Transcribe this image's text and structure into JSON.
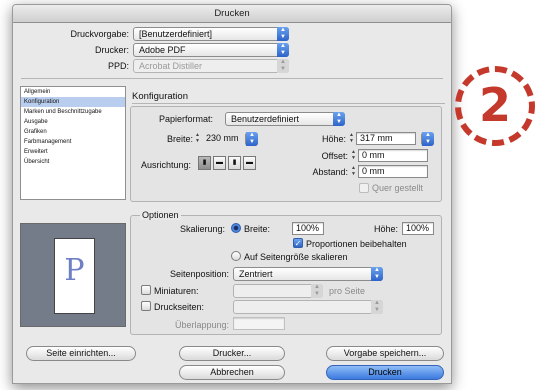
{
  "window": {
    "title": "Drucken"
  },
  "top": {
    "preset_label": "Druckvorgabe:",
    "preset_value": "[Benutzerdefiniert]",
    "printer_label": "Drucker:",
    "printer_value": "Adobe PDF",
    "ppd_label": "PPD:",
    "ppd_value": "Acrobat Distiller"
  },
  "sidebar": {
    "items": [
      {
        "label": "Allgemein",
        "selected": false
      },
      {
        "label": "Konfiguration",
        "selected": true
      },
      {
        "label": "Marken und Beschnittzugabe",
        "selected": false
      },
      {
        "label": "Ausgabe",
        "selected": false
      },
      {
        "label": "Grafiken",
        "selected": false
      },
      {
        "label": "Farbmanagement",
        "selected": false
      },
      {
        "label": "Erweitert",
        "selected": false
      },
      {
        "label": "Übersicht",
        "selected": false
      }
    ]
  },
  "preview": {
    "letter": "P"
  },
  "konfiguration": {
    "section_title": "Konfiguration",
    "paper_label": "Papierformat:",
    "paper_value": "Benutzerdefiniert",
    "width_label": "Breite:",
    "width_value": "230 mm",
    "height_label": "Höhe:",
    "height_value": "317 mm",
    "offset_label": "Offset:",
    "offset_value": "0 mm",
    "gap_label": "Abstand:",
    "gap_value": "0 mm",
    "orientation_label": "Ausrichtung:",
    "transverse_label": "Quer gestellt"
  },
  "optionen": {
    "section_title": "Optionen",
    "scaling_label": "Skalierung:",
    "width_radio_label": "Breite:",
    "width_value": "100%",
    "height_label": "Höhe:",
    "height_value": "100%",
    "proportions_label": "Proportionen beibehalten",
    "fit_label": "Auf Seitengröße skalieren",
    "position_label": "Seitenposition:",
    "position_value": "Zentriert",
    "thumbnails_label": "Miniaturen:",
    "per_page_label": "pro Seite",
    "tiling_label": "Druckseiten:",
    "overlap_label": "Überlappung:"
  },
  "buttons": {
    "page_setup": "Seite einrichten...",
    "printer": "Drucker...",
    "save_preset": "Vorgabe speichern...",
    "cancel": "Abbrechen",
    "print": "Drucken"
  },
  "badge": {
    "number": "2",
    "color": "#c4392b"
  }
}
